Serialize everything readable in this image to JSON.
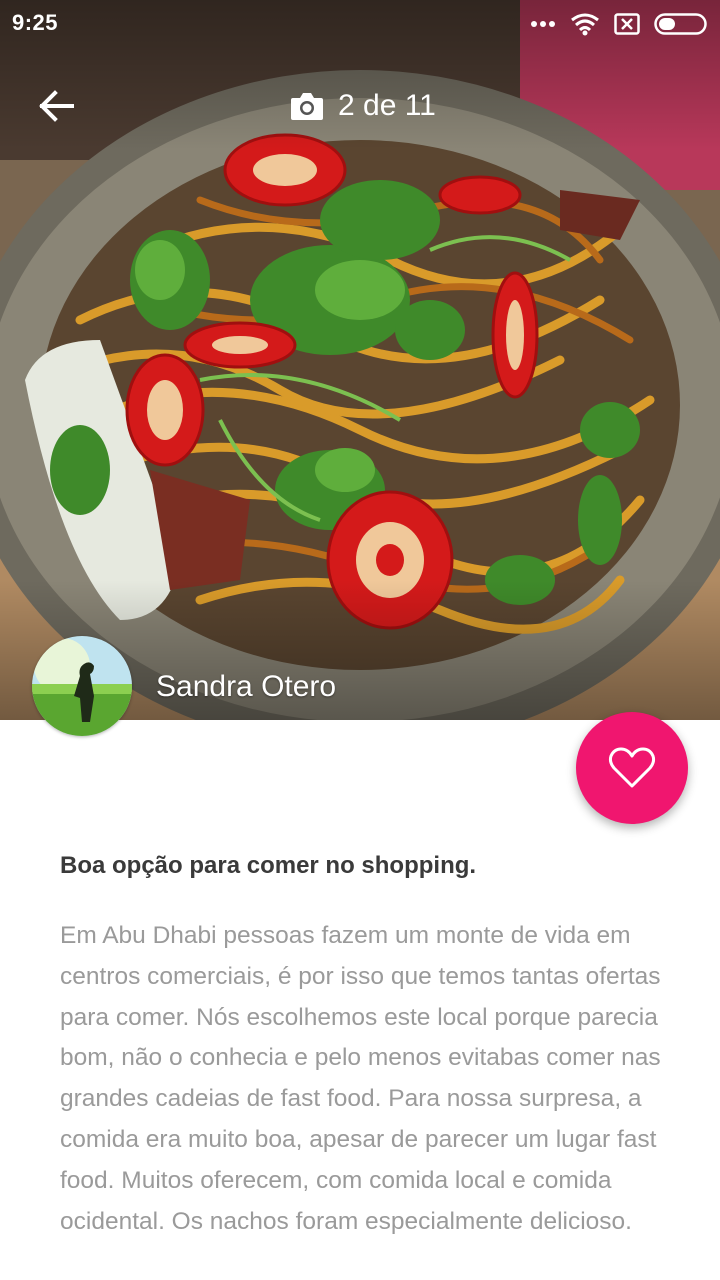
{
  "status_bar": {
    "time": "9:25"
  },
  "toolbar": {
    "back_icon": "arrow-left-icon",
    "camera_icon": "camera-icon",
    "photo_counter": "2 de 11"
  },
  "author": {
    "name": "Sandra Otero"
  },
  "favorite": {
    "icon": "heart-outline-icon",
    "color": "#f0166f"
  },
  "review": {
    "title": "Boa opção para comer no shopping.",
    "body": "Em Abu Dhabi pessoas fazem um monte de vida em centros comerciais, é por isso que temos tantas ofertas para comer. Nós escolhemos este local porque parecia bom, não o conhecia e pelo menos evitabas comer nas grandes cadeias de fast food. Para nossa surpresa, a comida era muito boa, apesar de parecer um lugar fast food. Muitos oferecem, com comida local e comida ocidental. Os nachos foram especialmente delicioso."
  }
}
